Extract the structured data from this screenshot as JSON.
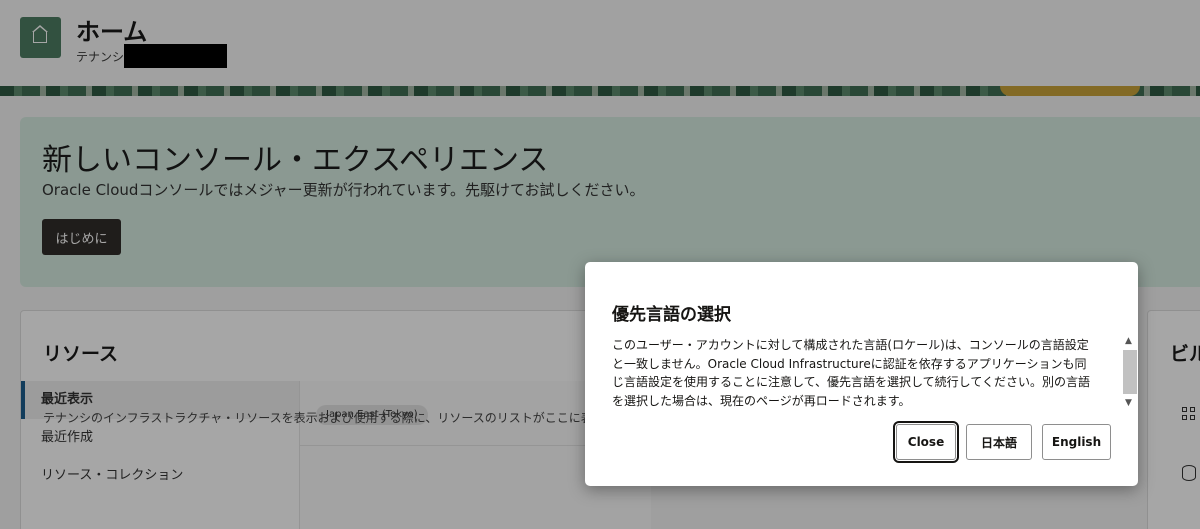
{
  "header": {
    "title": "ホーム",
    "tenancy_label": "テナンシ"
  },
  "banner": {
    "title": "新しいコンソール・エクスペリエンス",
    "subtitle": "Oracle Cloudコンソールではメジャー更新が行われています。先駆けてお試しください。",
    "button_label": "はじめに"
  },
  "resources": {
    "title": "リソース",
    "nav": [
      "最近表示",
      "最近作成",
      "リソース・コレクション"
    ],
    "region": "Japan East (Tokyo)",
    "description": "テナンシのインフラストラクチャ・リソースを表示および使用する際に、リソースのリストがここに表示されます。"
  },
  "billing": {
    "title": "ビル"
  },
  "modal": {
    "title": "優先言語の選択",
    "body": "このユーザー・アカウントに対して構成された言語(ロケール)は、コンソールの言語設定と一致しません。Oracle Cloud Infrastructureに認証を依存するアプリケーションも同じ言語設定を使用することに注意して、優先言語を選択して続行してください。別の言語を選択した場合は、現在のページが再ロードされます。",
    "buttons": {
      "close": "Close",
      "japanese": "日本語",
      "english": "English"
    }
  },
  "icons": {
    "home": "home-icon",
    "apps": "apps-icon",
    "database": "database-icon"
  },
  "colors": {
    "brand_green": "#4d7d63",
    "banner_bg": "#d6ece1",
    "primary_button": "#312d2a",
    "nav_accent": "#1c5c8c"
  }
}
